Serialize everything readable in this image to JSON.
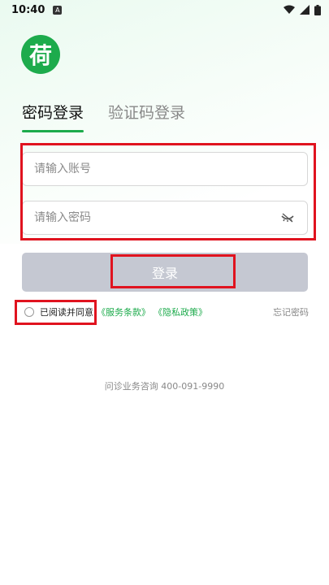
{
  "status_bar": {
    "time": "10:40",
    "notification_letter": "A"
  },
  "logo": {
    "text": "荷"
  },
  "tabs": [
    {
      "label": "密码登录",
      "active": true
    },
    {
      "label": "验证码登录",
      "active": false
    }
  ],
  "form": {
    "account_placeholder": "请输入账号",
    "account_value": "",
    "password_placeholder": "请输入密码",
    "password_value": "",
    "login_label": "登录"
  },
  "agreement": {
    "text": "已阅读并同意",
    "service_link": "《服务条款》",
    "privacy_link": "《隐私政策》",
    "forgot_label": "忘记密码"
  },
  "hotline": "问诊业务咨询 400-091-9990",
  "colors": {
    "brand_green": "#1dab4c",
    "button_disabled": "#c5c8d2",
    "highlight_red": "#e0131f"
  }
}
